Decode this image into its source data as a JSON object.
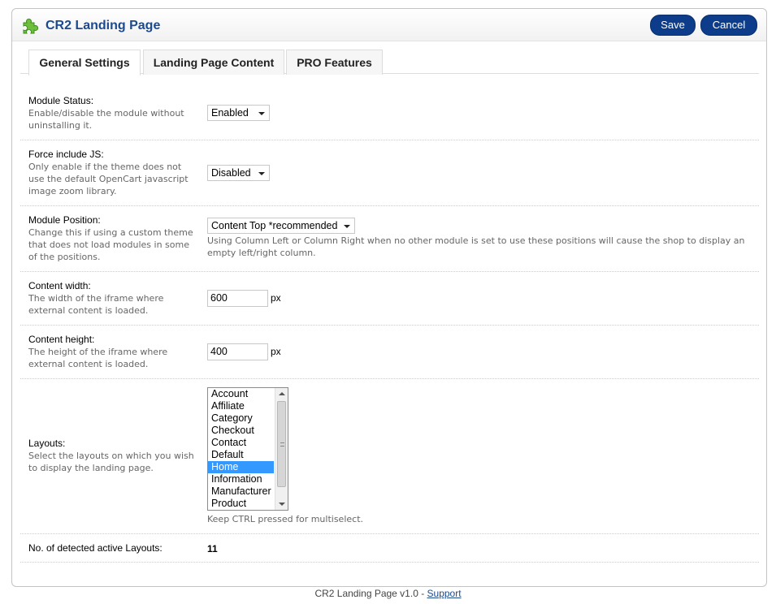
{
  "header": {
    "title": "CR2 Landing Page",
    "icon": "puzzle-piece-icon",
    "save_label": "Save",
    "cancel_label": "Cancel",
    "accent_color": "#0c3c8a"
  },
  "tabs": [
    {
      "label": "General Settings",
      "active": true
    },
    {
      "label": "Landing Page Content",
      "active": false
    },
    {
      "label": "PRO Features",
      "active": false
    }
  ],
  "settings": {
    "module_status": {
      "title": "Module Status:",
      "help": "Enable/disable the module without uninstalling it.",
      "value": "Enabled"
    },
    "force_js": {
      "title": "Force include JS:",
      "help": "Only enable if the theme does not use the default OpenCart javascript image zoom library.",
      "value": "Disabled"
    },
    "module_position": {
      "title": "Module Position:",
      "help": "Change this if using a custom theme that does not load modules in some of the positions.",
      "value": "Content Top *recommended",
      "note": "Using Column Left or Column Right when no other module is set to use these positions will cause the shop to display an empty left/right column."
    },
    "content_width": {
      "title": "Content width:",
      "help": "The width of the iframe where external content is loaded.",
      "value": "600",
      "unit": "px"
    },
    "content_height": {
      "title": "Content height:",
      "help": "The height of the iframe where external content is loaded.",
      "value": "400",
      "unit": "px"
    },
    "layouts": {
      "title": "Layouts:",
      "help": "Select the layouts on which you wish to display the landing page.",
      "options": [
        "Account",
        "Affiliate",
        "Category",
        "Checkout",
        "Contact",
        "Default",
        "Home",
        "Information",
        "Manufacturer",
        "Product"
      ],
      "selected": "Home",
      "note": "Keep CTRL pressed for multiselect."
    },
    "active_layouts": {
      "title": "No. of detected active Layouts:",
      "value": "11"
    }
  },
  "footer": {
    "text": "CR2 Landing Page v1.0 - ",
    "link": "Support"
  }
}
